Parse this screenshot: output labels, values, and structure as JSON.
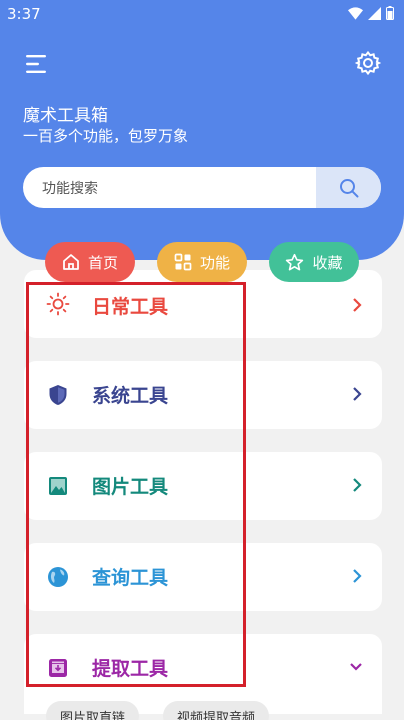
{
  "status_bar": {
    "time": "3:37"
  },
  "header": {
    "title": "魔术工具箱",
    "subtitle": "一百多个功能，包罗万象"
  },
  "search": {
    "placeholder": "功能搜索"
  },
  "nav_pills": [
    {
      "label": "首页",
      "icon": "home-icon",
      "color": "#ee5a52"
    },
    {
      "label": "功能",
      "icon": "grid-icon",
      "color": "#efb246"
    },
    {
      "label": "收藏",
      "icon": "star-icon",
      "color": "#42c198"
    }
  ],
  "categories": [
    {
      "label": "日常工具",
      "icon": "sun-icon",
      "color": "#e9493f",
      "chevron": "right"
    },
    {
      "label": "系统工具",
      "icon": "shield-icon",
      "color": "#3a4590",
      "chevron": "right"
    },
    {
      "label": "图片工具",
      "icon": "image-icon",
      "color": "#14897c",
      "chevron": "right"
    },
    {
      "label": "查询工具",
      "icon": "globe-icon",
      "color": "#2c94d6",
      "chevron": "right"
    },
    {
      "label": "提取工具",
      "icon": "archive-icon",
      "color": "#9c27a6",
      "chevron": "down"
    }
  ],
  "extract_tools": [
    {
      "label": "图片取直链"
    },
    {
      "label": "视频提取音频"
    }
  ],
  "colors": {
    "header_bg": "#5585e9",
    "highlight": "#d4202a"
  }
}
